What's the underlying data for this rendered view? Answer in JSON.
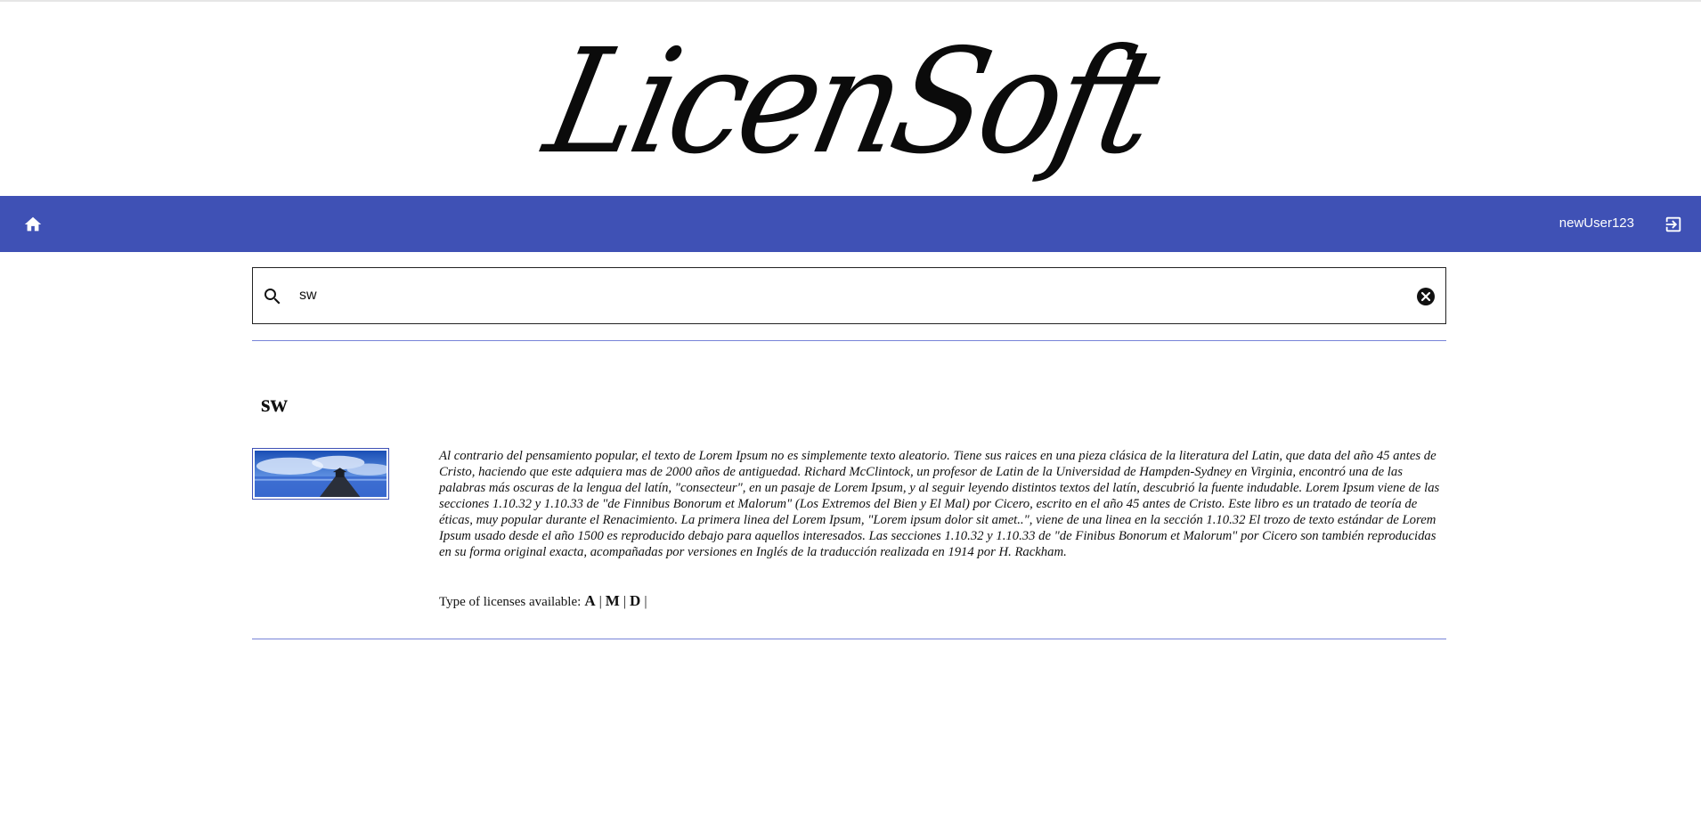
{
  "header": {
    "logo_text": "LicenSoft"
  },
  "navbar": {
    "home_icon": "home-icon",
    "username": "newUser123",
    "logout_icon": "logout-icon",
    "color": "#3f51b5"
  },
  "search": {
    "value": "sw",
    "placeholder": "",
    "search_icon": "search-icon",
    "clear_icon": "clear-icon"
  },
  "result": {
    "title": "sw",
    "description": "Al contrario del pensamiento popular, el texto de Lorem Ipsum no es simplemente texto aleatorio. Tiene sus raices en una pieza clásica de la literatura del Latin, que data del año 45 antes de Cristo, haciendo que este adquiera mas de 2000 años de antiguedad. Richard McClintock, un profesor de Latin de la Universidad de Hampden-Sydney en Virginia, encontró una de las palabras más oscuras de la lengua del latín, \"consecteur\", en un pasaje de Lorem Ipsum, y al seguir leyendo distintos textos del latín, descubrió la fuente indudable. Lorem Ipsum viene de las secciones 1.10.32 y 1.10.33 de \"de Finnibus Bonorum et Malorum\" (Los Extremos del Bien y El Mal) por Cicero, escrito en el año 45 antes de Cristo. Este libro es un tratado de teoría de éticas, muy popular durante el Renacimiento. La primera linea del Lorem Ipsum, \"Lorem ipsum dolor sit amet..\", viene de una linea en la sección 1.10.32 El trozo de texto estándar de Lorem Ipsum usado desde el año 1500 es reproducido debajo para aquellos interesados. Las secciones 1.10.32 y 1.10.33 de \"de Finibus Bonorum et Malorum\" por Cicero son también reproducidas en su forma original exacta, acompañadas por versiones en Inglés de la traducción realizada en 1914 por H. Rackham.",
    "licenses_label": "Type of licenses available:",
    "licenses": [
      "A",
      "M",
      "D"
    ],
    "separator": "|"
  }
}
